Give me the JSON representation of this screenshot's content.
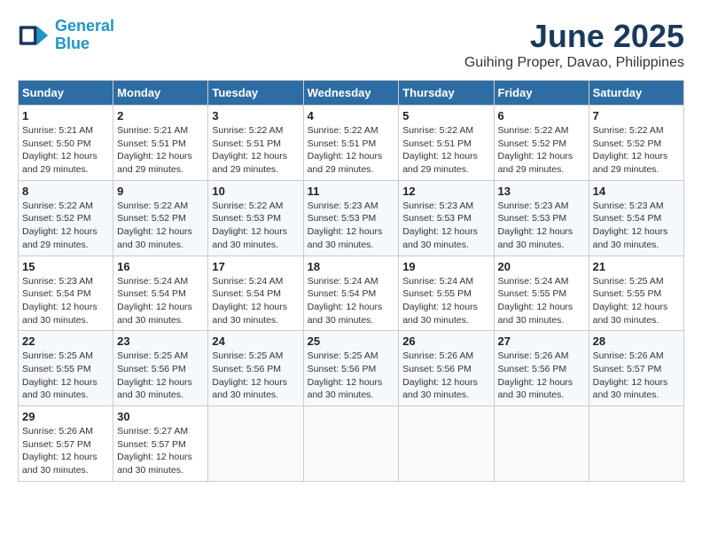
{
  "logo": {
    "line1": "General",
    "line2": "Blue"
  },
  "title": "June 2025",
  "location": "Guihing Proper, Davao, Philippines",
  "weekdays": [
    "Sunday",
    "Monday",
    "Tuesday",
    "Wednesday",
    "Thursday",
    "Friday",
    "Saturday"
  ],
  "weeks": [
    [
      {
        "day": "1",
        "sunrise": "5:21 AM",
        "sunset": "5:50 PM",
        "daylight": "12 hours and 29 minutes."
      },
      {
        "day": "2",
        "sunrise": "5:21 AM",
        "sunset": "5:51 PM",
        "daylight": "12 hours and 29 minutes."
      },
      {
        "day": "3",
        "sunrise": "5:22 AM",
        "sunset": "5:51 PM",
        "daylight": "12 hours and 29 minutes."
      },
      {
        "day": "4",
        "sunrise": "5:22 AM",
        "sunset": "5:51 PM",
        "daylight": "12 hours and 29 minutes."
      },
      {
        "day": "5",
        "sunrise": "5:22 AM",
        "sunset": "5:51 PM",
        "daylight": "12 hours and 29 minutes."
      },
      {
        "day": "6",
        "sunrise": "5:22 AM",
        "sunset": "5:52 PM",
        "daylight": "12 hours and 29 minutes."
      },
      {
        "day": "7",
        "sunrise": "5:22 AM",
        "sunset": "5:52 PM",
        "daylight": "12 hours and 29 minutes."
      }
    ],
    [
      {
        "day": "8",
        "sunrise": "5:22 AM",
        "sunset": "5:52 PM",
        "daylight": "12 hours and 29 minutes."
      },
      {
        "day": "9",
        "sunrise": "5:22 AM",
        "sunset": "5:52 PM",
        "daylight": "12 hours and 30 minutes."
      },
      {
        "day": "10",
        "sunrise": "5:22 AM",
        "sunset": "5:53 PM",
        "daylight": "12 hours and 30 minutes."
      },
      {
        "day": "11",
        "sunrise": "5:23 AM",
        "sunset": "5:53 PM",
        "daylight": "12 hours and 30 minutes."
      },
      {
        "day": "12",
        "sunrise": "5:23 AM",
        "sunset": "5:53 PM",
        "daylight": "12 hours and 30 minutes."
      },
      {
        "day": "13",
        "sunrise": "5:23 AM",
        "sunset": "5:53 PM",
        "daylight": "12 hours and 30 minutes."
      },
      {
        "day": "14",
        "sunrise": "5:23 AM",
        "sunset": "5:54 PM",
        "daylight": "12 hours and 30 minutes."
      }
    ],
    [
      {
        "day": "15",
        "sunrise": "5:23 AM",
        "sunset": "5:54 PM",
        "daylight": "12 hours and 30 minutes."
      },
      {
        "day": "16",
        "sunrise": "5:24 AM",
        "sunset": "5:54 PM",
        "daylight": "12 hours and 30 minutes."
      },
      {
        "day": "17",
        "sunrise": "5:24 AM",
        "sunset": "5:54 PM",
        "daylight": "12 hours and 30 minutes."
      },
      {
        "day": "18",
        "sunrise": "5:24 AM",
        "sunset": "5:54 PM",
        "daylight": "12 hours and 30 minutes."
      },
      {
        "day": "19",
        "sunrise": "5:24 AM",
        "sunset": "5:55 PM",
        "daylight": "12 hours and 30 minutes."
      },
      {
        "day": "20",
        "sunrise": "5:24 AM",
        "sunset": "5:55 PM",
        "daylight": "12 hours and 30 minutes."
      },
      {
        "day": "21",
        "sunrise": "5:25 AM",
        "sunset": "5:55 PM",
        "daylight": "12 hours and 30 minutes."
      }
    ],
    [
      {
        "day": "22",
        "sunrise": "5:25 AM",
        "sunset": "5:55 PM",
        "daylight": "12 hours and 30 minutes."
      },
      {
        "day": "23",
        "sunrise": "5:25 AM",
        "sunset": "5:56 PM",
        "daylight": "12 hours and 30 minutes."
      },
      {
        "day": "24",
        "sunrise": "5:25 AM",
        "sunset": "5:56 PM",
        "daylight": "12 hours and 30 minutes."
      },
      {
        "day": "25",
        "sunrise": "5:25 AM",
        "sunset": "5:56 PM",
        "daylight": "12 hours and 30 minutes."
      },
      {
        "day": "26",
        "sunrise": "5:26 AM",
        "sunset": "5:56 PM",
        "daylight": "12 hours and 30 minutes."
      },
      {
        "day": "27",
        "sunrise": "5:26 AM",
        "sunset": "5:56 PM",
        "daylight": "12 hours and 30 minutes."
      },
      {
        "day": "28",
        "sunrise": "5:26 AM",
        "sunset": "5:57 PM",
        "daylight": "12 hours and 30 minutes."
      }
    ],
    [
      {
        "day": "29",
        "sunrise": "5:26 AM",
        "sunset": "5:57 PM",
        "daylight": "12 hours and 30 minutes."
      },
      {
        "day": "30",
        "sunrise": "5:27 AM",
        "sunset": "5:57 PM",
        "daylight": "12 hours and 30 minutes."
      },
      null,
      null,
      null,
      null,
      null
    ]
  ]
}
